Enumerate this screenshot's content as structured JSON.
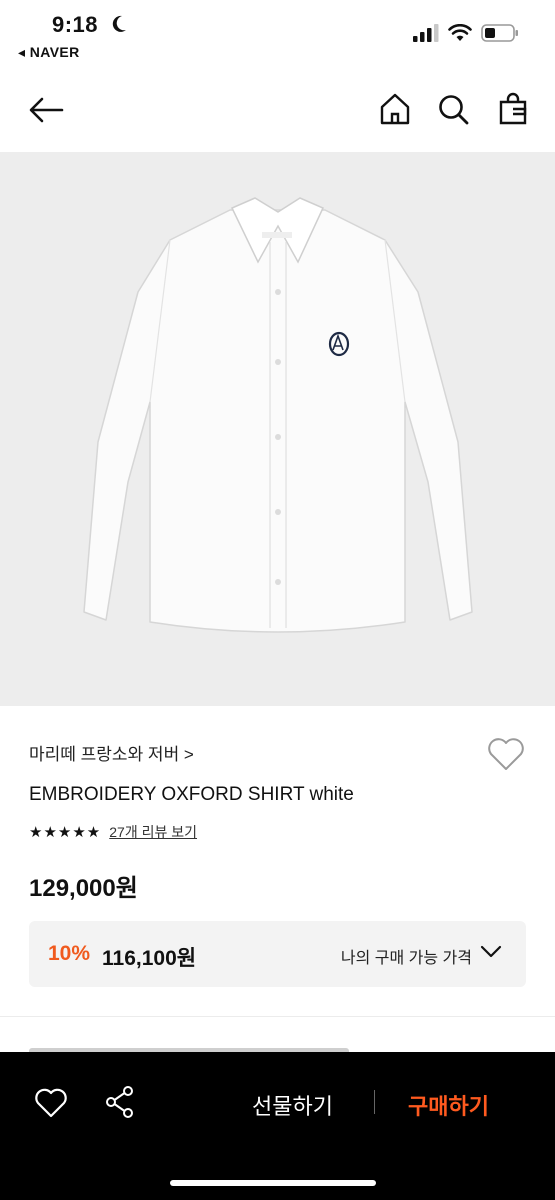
{
  "status_bar": {
    "time": "9:18",
    "back_app": "◂ NAVER"
  },
  "product": {
    "brand": "마리떼 프랑소와 저버 >",
    "title": "EMBROIDERY OXFORD SHIRT white",
    "stars": "★★★★★",
    "rating_value": 5,
    "review_link": "27개 리뷰 보기",
    "price": "129,000원",
    "discount_percent": "10%",
    "discount_price": "116,100원",
    "my_price_label": "나의 구매 가능 가격"
  },
  "bottom_bar": {
    "gift_label": "선물하기",
    "buy_label": "구매하기"
  },
  "colors": {
    "accent": "#f05a1e",
    "buy": "#ff5a1f",
    "bottom_bg": "#000000",
    "image_bg": "#ededed"
  }
}
